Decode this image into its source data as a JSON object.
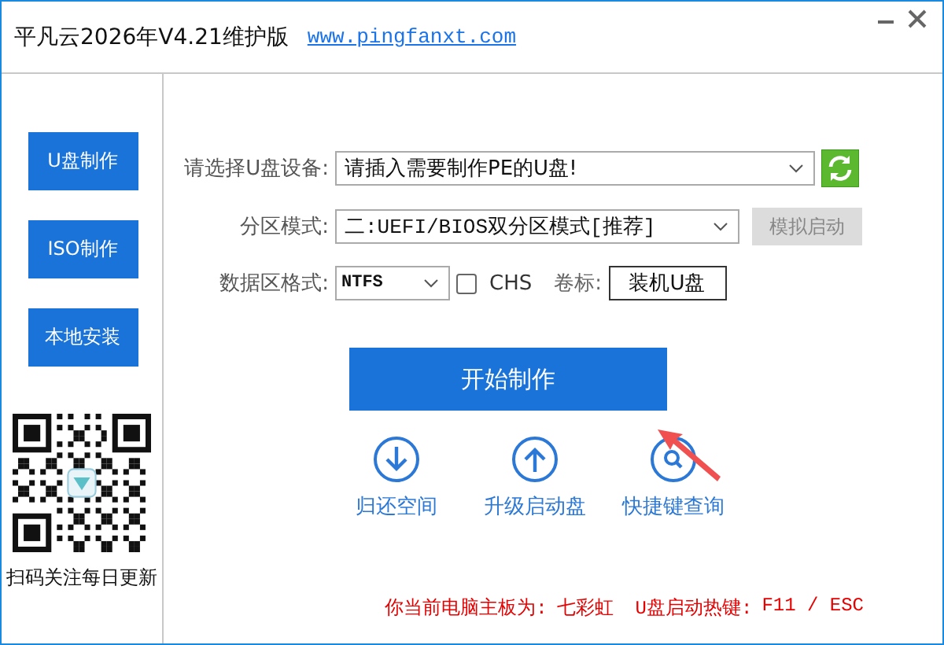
{
  "window": {
    "title": "平凡云2026年V4.21维护版",
    "link": "www.pingfanxt.com"
  },
  "sidebar": {
    "items": [
      {
        "label": "U盘制作"
      },
      {
        "label": "ISO制作"
      },
      {
        "label": "本地安装"
      }
    ],
    "qr_caption": "扫码关注每日更新"
  },
  "form": {
    "rows": [
      {
        "kind": "device",
        "label": "请选择U盘设备:",
        "value": "请插入需要制作PE的U盘!"
      },
      {
        "kind": "mode",
        "label": "分区模式:",
        "value": "二:UEFI/BIOS双分区模式[推荐]",
        "button": {
          "label": "模拟启动",
          "disabled": true
        }
      },
      {
        "kind": "format",
        "label": "数据区格式:",
        "value": "NTFS",
        "checkbox": {
          "label": "CHS",
          "checked": false
        },
        "volume_label": "卷标:",
        "volume": "装机U盘"
      }
    ]
  },
  "start_button": "开始制作",
  "actions": [
    {
      "kind": "down",
      "label": "归还空间"
    },
    {
      "kind": "up",
      "label": "升级启动盘"
    },
    {
      "kind": "search",
      "label": "快捷键查询"
    }
  ],
  "status": {
    "board_label": "你当前电脑主板为:",
    "board": "七彩虹",
    "hotkey_label": "U盘启动热键:",
    "hotkey": "F11 / ESC"
  }
}
